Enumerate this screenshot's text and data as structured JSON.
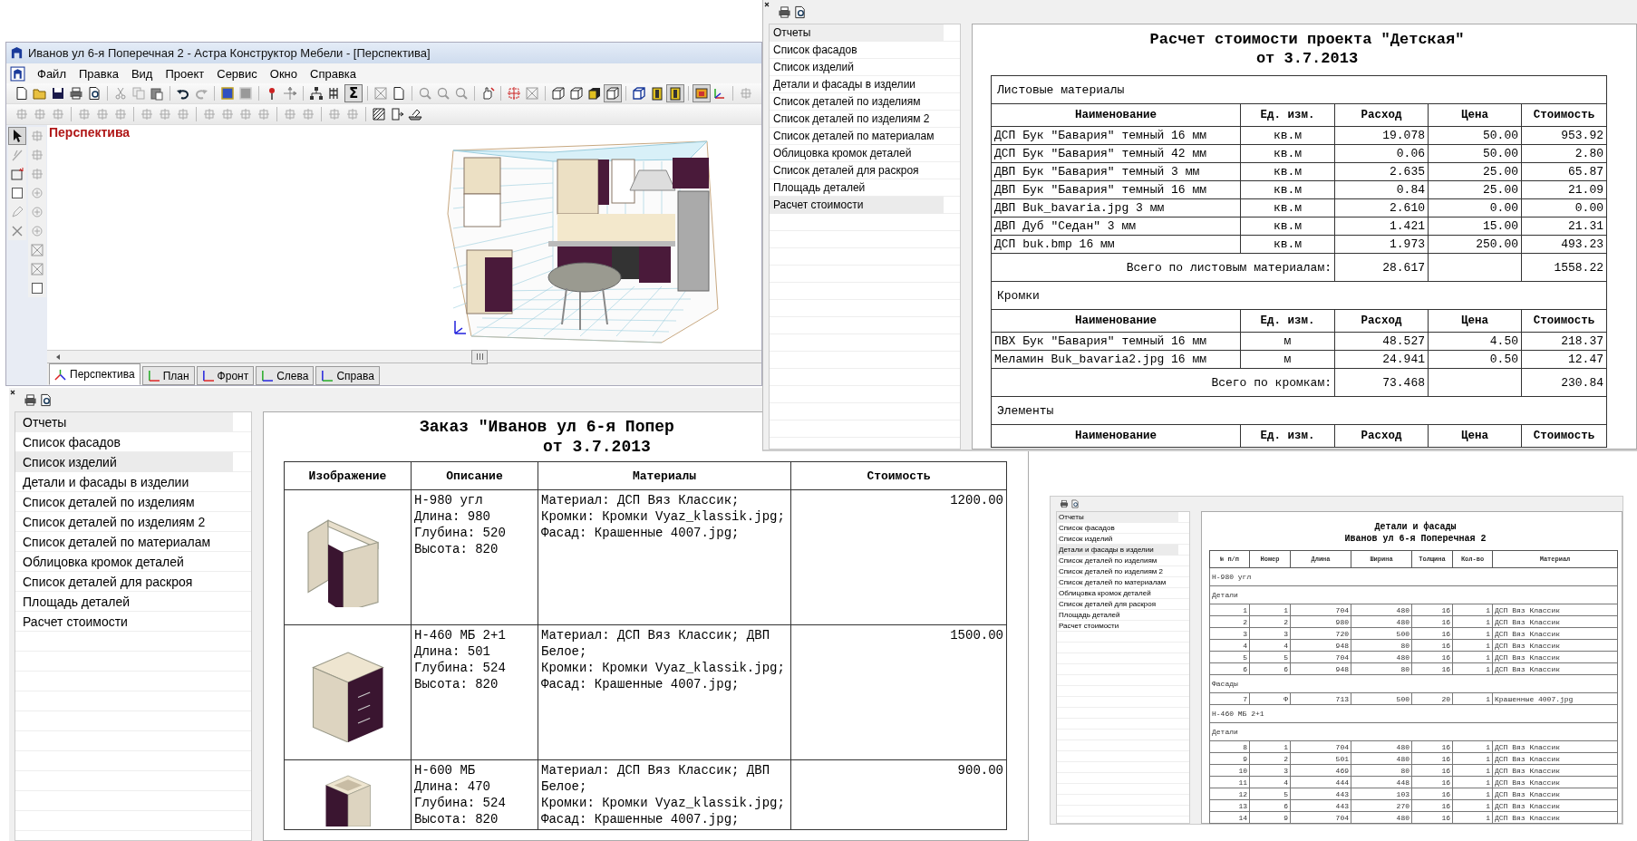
{
  "main_window": {
    "title": "Иванов ул 6-я Поперечная 2 - Астра Конструктор Мебели - [Перспектива]",
    "menu": [
      "Файл",
      "Правка",
      "Вид",
      "Проект",
      "Сервис",
      "Окно",
      "Справка"
    ],
    "sum_button": "Σ",
    "viewport_label": "Перспектива",
    "view_tabs": [
      {
        "label": "Перспектива",
        "kind": "perspective",
        "selected": true
      },
      {
        "label": "План",
        "kind": "plan",
        "selected": false
      },
      {
        "label": "Фронт",
        "kind": "front",
        "selected": false
      },
      {
        "label": "Слева",
        "kind": "left",
        "selected": false
      },
      {
        "label": "Справа",
        "kind": "right",
        "selected": false
      }
    ]
  },
  "order_report": {
    "reports_header": "Отчеты",
    "reports": [
      {
        "label": "Список фасадов",
        "selected": false
      },
      {
        "label": "Список изделий",
        "selected": true
      },
      {
        "label": "Детали и фасады в изделии",
        "selected": false
      },
      {
        "label": "Список деталей по изделиям",
        "selected": false
      },
      {
        "label": "Список деталей по изделиям 2",
        "selected": false
      },
      {
        "label": "Список деталей по материалам",
        "selected": false
      },
      {
        "label": "Облицовка кромок деталей",
        "selected": false
      },
      {
        "label": "Список деталей для раскроя",
        "selected": false
      },
      {
        "label": "Площадь деталей",
        "selected": false
      },
      {
        "label": "Расчет стоимости",
        "selected": false
      }
    ],
    "title": "Заказ \"Иванов ул 6-я Попер",
    "date": "от 3.7.2013",
    "columns": [
      "Изображение",
      "Описание",
      "Материалы",
      "Стоимость"
    ],
    "rows": [
      {
        "kind": "corner",
        "description": [
          "Н-980 угл",
          "Длина: 980",
          "Глубина: 520",
          "Высота: 820"
        ],
        "materials": [
          "Материал: ДСП Вяз Классик;",
          "Кромки: Кромки Vyaz_klassik.jpg;",
          "Фасад: Крашенные 4007.jpg;"
        ],
        "cost": "1200.00"
      },
      {
        "kind": "drawers",
        "description": [
          "Н-460 МБ 2+1",
          "Длина: 501",
          "Глубина: 524",
          "Высота: 820"
        ],
        "materials": [
          "Материал: ДСП Вяз Классик; ДВП",
          "Белое;",
          "Кромки: Кромки Vyaz_klassik.jpg;",
          "Фасад: Крашенные 4007.jpg;"
        ],
        "cost": "1500.00"
      },
      {
        "kind": "open",
        "description": [
          "Н-600 МБ",
          "Длина: 470",
          "Глубина: 524",
          "Высота: 820"
        ],
        "materials": [
          "Материал: ДСП Вяз Классик; ДВП",
          "Белое;",
          "Кромки: Кромки Vyaz_klassik.jpg;",
          "Фасад: Крашенные 4007.jpg;"
        ],
        "cost": "900.00"
      }
    ]
  },
  "cost_report": {
    "reports_header": "Отчеты",
    "reports": [
      {
        "label": "Список фасадов",
        "selected": false
      },
      {
        "label": "Список изделий",
        "selected": false
      },
      {
        "label": "Детали и фасады в изделии",
        "selected": false
      },
      {
        "label": "Список деталей по изделиям",
        "selected": false
      },
      {
        "label": "Список деталей по изделиям 2",
        "selected": false
      },
      {
        "label": "Список деталей по материалам",
        "selected": false
      },
      {
        "label": "Облицовка кромок деталей",
        "selected": false
      },
      {
        "label": "Список деталей для раскроя",
        "selected": false
      },
      {
        "label": "Площадь деталей",
        "selected": false
      },
      {
        "label": "Расчет стоимости",
        "selected": true
      }
    ],
    "title": "Расчет стоимости проекта \"Детская\"",
    "date": "от 3.7.2013",
    "sections": [
      {
        "name": "Листовые материалы",
        "columns": [
          "Наименование",
          "Ед. изм.",
          "Расход",
          "Цена",
          "Стоимость"
        ],
        "rows": [
          [
            "ДСП Бук \"Бавария\" темный 16 мм",
            "кв.м",
            "19.078",
            "50.00",
            "953.92"
          ],
          [
            "ДСП Бук \"Бавария\" темный 42 мм",
            "кв.м",
            "0.06",
            "50.00",
            "2.80"
          ],
          [
            "ДВП Бук \"Бавария\" темный 3 мм",
            "кв.м",
            "2.635",
            "25.00",
            "65.87"
          ],
          [
            "ДВП Бук \"Бавария\" темный 16 мм",
            "кв.м",
            "0.84",
            "25.00",
            "21.09"
          ],
          [
            "ДВП Buk_bavaria.jpg 3 мм",
            "кв.м",
            "2.610",
            "0.00",
            "0.00"
          ],
          [
            "ДВП Дуб \"Седан\" 3 мм",
            "кв.м",
            "1.421",
            "15.00",
            "21.31"
          ],
          [
            "ДСП buk.bmp 16 мм",
            "кв.м",
            "1.973",
            "250.00",
            "493.23"
          ]
        ],
        "total": {
          "label": "Всего по листовым материалам:",
          "consumption": "28.617",
          "cost": "1558.22"
        }
      },
      {
        "name": "Кромки",
        "columns": [
          "Наименование",
          "Ед. изм.",
          "Расход",
          "Цена",
          "Стоимость"
        ],
        "rows": [
          [
            "ПВХ Бук \"Бавария\" темный 16 мм",
            "м",
            "48.527",
            "4.50",
            "218.37"
          ],
          [
            "Меламин Buk_bavaria2.jpg 16 мм",
            "м",
            "24.941",
            "0.50",
            "12.47"
          ]
        ],
        "total": {
          "label": "Всего по кромкам:",
          "consumption": "73.468",
          "cost": "230.84"
        }
      },
      {
        "name": "Элементы",
        "columns": [
          "Наименование",
          "Ед. изм.",
          "Расход",
          "Цена",
          "Стоимость"
        ]
      }
    ]
  },
  "details_report": {
    "reports_header": "Отчеты",
    "reports": [
      {
        "label": "Список фасадов",
        "selected": false
      },
      {
        "label": "Список изделий",
        "selected": false
      },
      {
        "label": "Детали и фасады в изделии",
        "selected": true
      },
      {
        "label": "Список деталей по изделиям",
        "selected": false
      },
      {
        "label": "Список деталей по изделиям 2",
        "selected": false
      },
      {
        "label": "Список деталей по материалам",
        "selected": false
      },
      {
        "label": "Облицовка кромок деталей",
        "selected": false
      },
      {
        "label": "Список деталей для раскроя",
        "selected": false
      },
      {
        "label": "Площадь деталей",
        "selected": false
      },
      {
        "label": "Расчет стоимости",
        "selected": false
      }
    ],
    "title": "Детали и фасады",
    "subtitle": "Иванов ул 6-я Поперечная 2",
    "columns": [
      "№ п/п",
      "Номер",
      "Длина",
      "Ширина",
      "Толщина",
      "Кол-во",
      "Материал"
    ],
    "rows": [
      {
        "kind": "heading",
        "text": "Н-980 угл"
      },
      {
        "kind": "heading",
        "text": "Детали"
      },
      {
        "kind": "part",
        "cells": [
          "1",
          "1",
          "704",
          "480",
          "16",
          "1",
          "ДСП Вяз Классик"
        ]
      },
      {
        "kind": "part",
        "cells": [
          "2",
          "2",
          "980",
          "480",
          "16",
          "1",
          "ДСП Вяз Классик"
        ]
      },
      {
        "kind": "part",
        "cells": [
          "3",
          "3",
          "720",
          "500",
          "16",
          "1",
          "ДСП Вяз Классик"
        ]
      },
      {
        "kind": "part",
        "cells": [
          "4",
          "4",
          "948",
          "80",
          "16",
          "1",
          "ДСП Вяз Классик"
        ]
      },
      {
        "kind": "part",
        "cells": [
          "5",
          "5",
          "704",
          "480",
          "16",
          "1",
          "ДСП Вяз Классик"
        ]
      },
      {
        "kind": "part",
        "cells": [
          "6",
          "6",
          "948",
          "80",
          "16",
          "1",
          "ДСП Вяз Классик"
        ]
      },
      {
        "kind": "heading",
        "text": "Фасады"
      },
      {
        "kind": "part",
        "cells": [
          "7",
          "Ф",
          "713",
          "500",
          "20",
          "1",
          "Крашенные 4007.jpg"
        ]
      },
      {
        "kind": "heading",
        "text": "Н-460 МБ 2+1"
      },
      {
        "kind": "heading",
        "text": "Детали"
      },
      {
        "kind": "part",
        "cells": [
          "8",
          "1",
          "704",
          "480",
          "16",
          "1",
          "ДСП Вяз Классик"
        ]
      },
      {
        "kind": "part",
        "cells": [
          "9",
          "2",
          "501",
          "480",
          "16",
          "1",
          "ДСП Вяз Классик"
        ]
      },
      {
        "kind": "part",
        "cells": [
          "10",
          "3",
          "469",
          "80",
          "16",
          "1",
          "ДСП Вяз Классик"
        ]
      },
      {
        "kind": "part",
        "cells": [
          "11",
          "4",
          "444",
          "448",
          "16",
          "1",
          "ДСП Вяз Классик"
        ]
      },
      {
        "kind": "part",
        "cells": [
          "12",
          "5",
          "443",
          "103",
          "16",
          "1",
          "ДСП Вяз Классик"
        ]
      },
      {
        "kind": "part",
        "cells": [
          "13",
          "6",
          "443",
          "270",
          "16",
          "1",
          "ДСП Вяз Классик"
        ]
      },
      {
        "kind": "part",
        "cells": [
          "14",
          "9",
          "704",
          "480",
          "16",
          "1",
          "ДСП Вяз Классик"
        ]
      }
    ]
  }
}
